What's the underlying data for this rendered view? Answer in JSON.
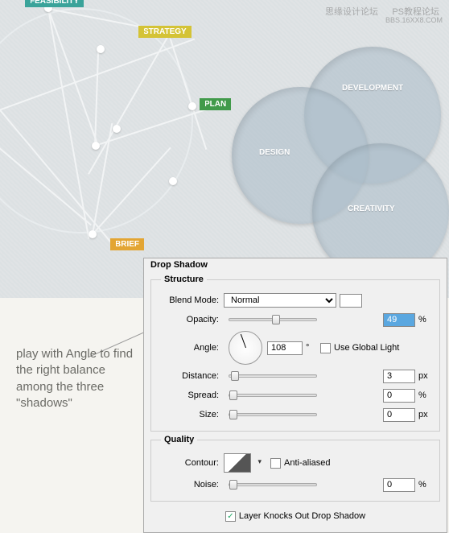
{
  "watermarks": {
    "a": "思缘设计论坛",
    "b": "PS教程论坛",
    "c": "BBS.16XX8.COM"
  },
  "tags": {
    "feasibility": "FEASIBILITY",
    "strategy": "STRATEGY",
    "plan": "PLAN",
    "brief": "BRIEF"
  },
  "venn": {
    "development": "DEVELOPMENT",
    "design": "DESIGN",
    "creativity": "CREATIVITY"
  },
  "annotation": "play with Angle to find the right balance among the three \"shadows\"",
  "panel": {
    "title": "Drop Shadow",
    "groups": {
      "structure": "Structure",
      "quality": "Quality"
    },
    "labels": {
      "blend": "Blend Mode:",
      "opacity": "Opacity:",
      "angle": "Angle:",
      "distance": "Distance:",
      "spread": "Spread:",
      "size": "Size:",
      "contour": "Contour:",
      "noise": "Noise:"
    },
    "blend_mode": "Normal",
    "opacity": "49",
    "angle": "108",
    "angle_unit": "°",
    "use_global_light": "Use Global Light",
    "distance": "3",
    "spread": "0",
    "size": "0",
    "anti_aliased": "Anti-aliased",
    "noise": "0",
    "knock": "Layer Knocks Out Drop Shadow",
    "pct": "%",
    "px": "px"
  }
}
